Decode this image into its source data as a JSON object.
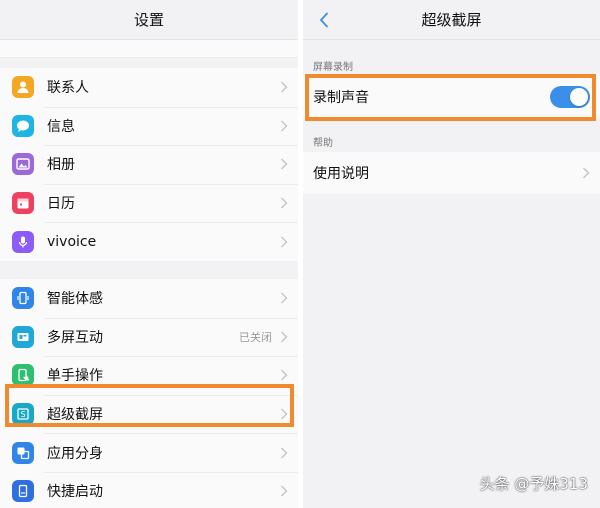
{
  "left": {
    "title": "设置",
    "group1": [
      {
        "label": "联系人",
        "icon": "contacts-icon",
        "color": "#f5a623"
      },
      {
        "label": "信息",
        "icon": "message-icon",
        "color": "#1fb4e6"
      },
      {
        "label": "相册",
        "icon": "album-icon",
        "color": "#9b6ad8"
      },
      {
        "label": "日历",
        "icon": "calendar-icon",
        "color": "#ee4160"
      },
      {
        "label": "vivoice",
        "icon": "microphone-icon",
        "color": "#8b5cf6"
      }
    ],
    "group2": [
      {
        "label": "智能体感",
        "icon": "phone-motion-icon",
        "color": "#2f86e8",
        "value": ""
      },
      {
        "label": "多屏互动",
        "icon": "multiscreen-icon",
        "color": "#1fa8d8",
        "value": "已关闭"
      },
      {
        "label": "单手操作",
        "icon": "hand-icon",
        "color": "#2fbf71",
        "value": ""
      },
      {
        "label": "超级截屏",
        "icon": "screenshot-icon",
        "color": "#18a8c8",
        "value": ""
      },
      {
        "label": "应用分身",
        "icon": "app-clone-icon",
        "color": "#2f86e8",
        "value": ""
      },
      {
        "label": "快捷启动",
        "icon": "quick-launch-icon",
        "color": "#2f6fe0",
        "value": ""
      }
    ]
  },
  "right": {
    "title": "超级截屏",
    "section1_header": "屏幕录制",
    "record_audio_label": "录制声音",
    "record_audio_enabled": true,
    "section2_header": "帮助",
    "help_label": "使用说明"
  },
  "watermark": "头条 @予姝313",
  "colors": {
    "highlight": "#ef8a2e",
    "toggle_on": "#3a90e8",
    "back_arrow": "#3a90e8"
  }
}
